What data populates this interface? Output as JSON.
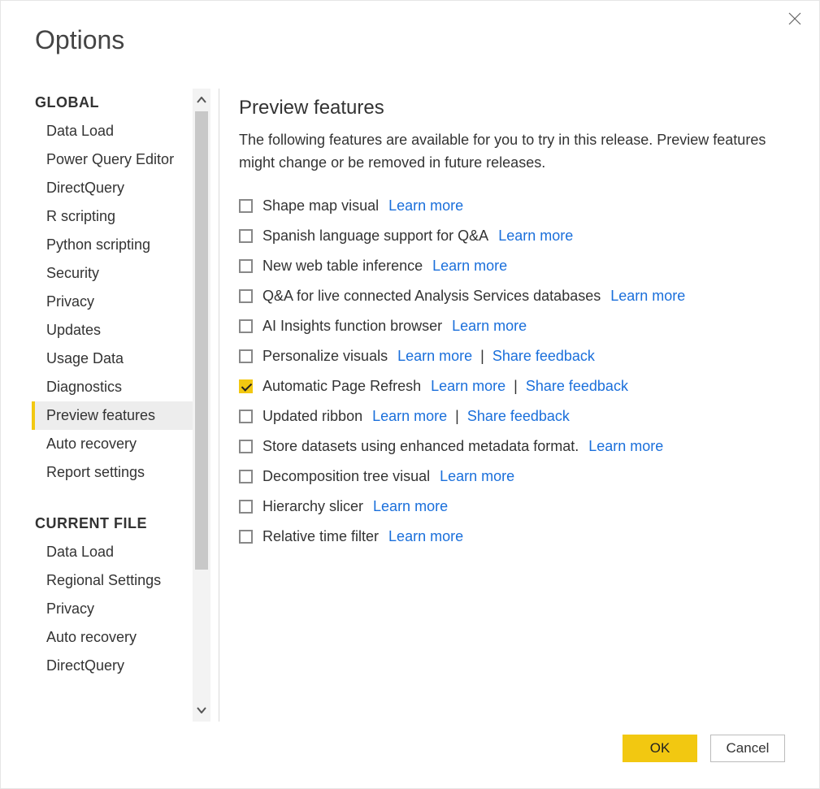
{
  "title": "Options",
  "sidebar": {
    "sections": [
      {
        "header": "GLOBAL",
        "items": [
          "Data Load",
          "Power Query Editor",
          "DirectQuery",
          "R scripting",
          "Python scripting",
          "Security",
          "Privacy",
          "Updates",
          "Usage Data",
          "Diagnostics",
          "Preview features",
          "Auto recovery",
          "Report settings"
        ],
        "selected_index": 10
      },
      {
        "header": "CURRENT FILE",
        "items": [
          "Data Load",
          "Regional Settings",
          "Privacy",
          "Auto recovery",
          "DirectQuery"
        ],
        "selected_index": -1
      }
    ]
  },
  "content": {
    "section_title": "Preview features",
    "description": "The following features are available for you to try in this release. Preview features might change or be removed in future releases.",
    "learn_more_label": "Learn more",
    "share_feedback_label": "Share feedback",
    "features": [
      {
        "label": "Shape map visual",
        "checked": false,
        "learn_more": true,
        "share_feedback": false
      },
      {
        "label": "Spanish language support for Q&A",
        "checked": false,
        "learn_more": true,
        "share_feedback": false
      },
      {
        "label": "New web table inference",
        "checked": false,
        "learn_more": true,
        "share_feedback": false
      },
      {
        "label": "Q&A for live connected Analysis Services databases",
        "checked": false,
        "learn_more": true,
        "share_feedback": false
      },
      {
        "label": "AI Insights function browser",
        "checked": false,
        "learn_more": true,
        "share_feedback": false
      },
      {
        "label": "Personalize visuals",
        "checked": false,
        "learn_more": true,
        "share_feedback": true
      },
      {
        "label": "Automatic Page Refresh",
        "checked": true,
        "learn_more": true,
        "share_feedback": true
      },
      {
        "label": "Updated ribbon",
        "checked": false,
        "learn_more": true,
        "share_feedback": true
      },
      {
        "label": "Store datasets using enhanced metadata format.",
        "checked": false,
        "learn_more": true,
        "share_feedback": false
      },
      {
        "label": "Decomposition tree visual",
        "checked": false,
        "learn_more": true,
        "share_feedback": false
      },
      {
        "label": "Hierarchy slicer",
        "checked": false,
        "learn_more": true,
        "share_feedback": false
      },
      {
        "label": "Relative time filter",
        "checked": false,
        "learn_more": true,
        "share_feedback": false
      }
    ]
  },
  "buttons": {
    "ok": "OK",
    "cancel": "Cancel"
  }
}
